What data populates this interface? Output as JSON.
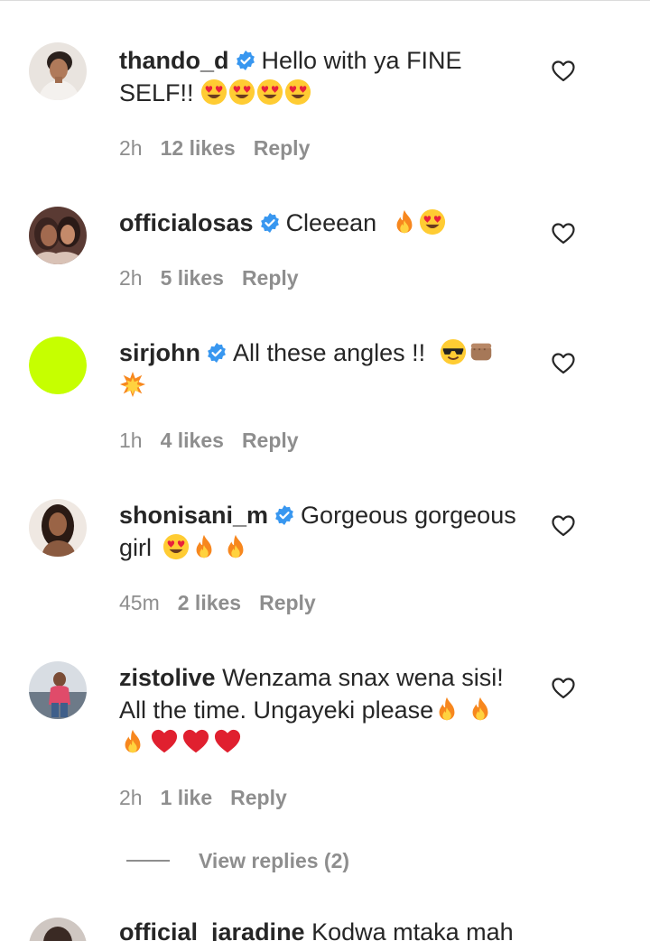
{
  "comments": [
    {
      "username": "thando_d",
      "verified": true,
      "text": "Hello with ya FINE SELF!!",
      "emojis": [
        "heart-eyes",
        "heart-eyes",
        "heart-eyes",
        "heart-eyes"
      ],
      "time": "2h",
      "likes": "12 likes",
      "reply": "Reply"
    },
    {
      "username": "officialosas",
      "verified": true,
      "text": "Cleeean",
      "emojis": [
        "fire",
        "heart-eyes"
      ],
      "time": "2h",
      "likes": "5 likes",
      "reply": "Reply"
    },
    {
      "username": "sirjohn",
      "verified": true,
      "text": "All these angles !!",
      "emojis": [
        "sunglasses",
        "fist",
        "collision"
      ],
      "time": "1h",
      "likes": "4 likes",
      "reply": "Reply"
    },
    {
      "username": "shonisani_m",
      "verified": true,
      "text": "Gorgeous gorgeous girl",
      "emojis": [
        "heart-eyes",
        "fire",
        "fire"
      ],
      "time": "45m",
      "likes": "2 likes",
      "reply": "Reply"
    },
    {
      "username": "zistolive",
      "verified": false,
      "text": "Wenzama snax wena sisi! All the time. Ungayeki please",
      "emojis": [
        "fire",
        "fire",
        "fire",
        "red-heart",
        "red-heart",
        "red-heart"
      ],
      "time": "2h",
      "likes": "1 like",
      "reply": "Reply"
    }
  ],
  "view_replies": "View replies (2)",
  "partial_comment": {
    "username": "official_jaradine",
    "text": "Kodwa mtaka mah"
  },
  "colors": {
    "text": "#262626",
    "meta": "#8e8e8e",
    "verified": "#3897f0",
    "avatar_lime": "#c6ff00"
  }
}
